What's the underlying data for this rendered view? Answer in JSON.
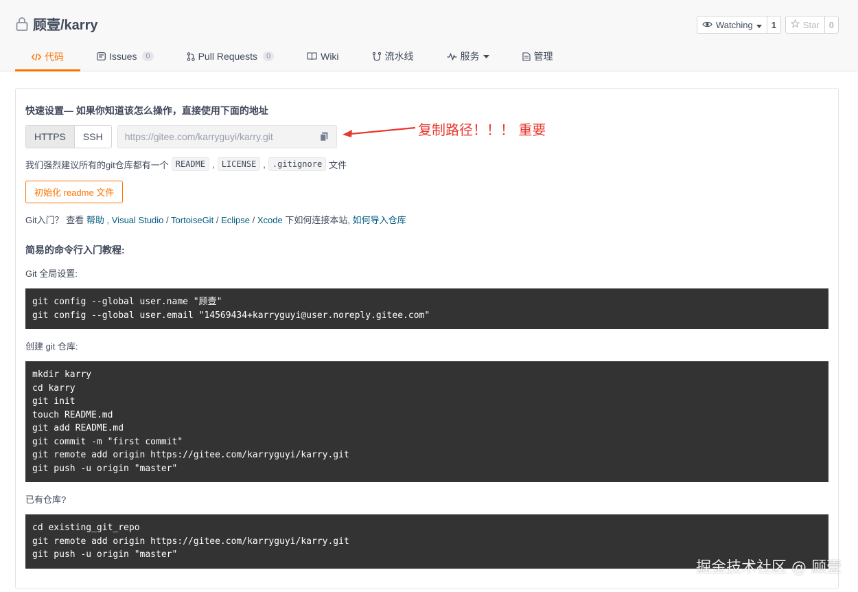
{
  "repo": {
    "name": "顾壹/karry"
  },
  "actions": {
    "watch": {
      "label": "Watching",
      "count": "1"
    },
    "star": {
      "label": "Star",
      "count": "0"
    }
  },
  "tabs": [
    {
      "label": "代码"
    },
    {
      "label": "Issues",
      "badge": "0"
    },
    {
      "label": "Pull Requests",
      "badge": "0"
    },
    {
      "label": "Wiki"
    },
    {
      "label": "流水线"
    },
    {
      "label": "服务"
    },
    {
      "label": "管理"
    }
  ],
  "quick": {
    "title": "快速设置— 如果你知道该怎么操作，直接使用下面的地址",
    "protocols": [
      "HTTPS",
      "SSH"
    ],
    "url_placeholder": "https://gitee.com/karryguyi/karry.git"
  },
  "annotation": {
    "text": "复制路径！！！ 重要"
  },
  "recommend": {
    "prefix": "我们强烈建议所有的git仓库都有一个",
    "files": [
      "README",
      "LICENSE",
      ".gitignore"
    ],
    "sep": ",",
    "suffix": "文件"
  },
  "init_button": "初始化 readme 文件",
  "git_help": {
    "prefix": "Git入门？ 查看",
    "help": "帮助",
    "tools_sep": ",",
    "vs": "Visual Studio",
    "tortoise": "TortoiseGit",
    "eclipse": "Eclipse",
    "xcode": "Xcode",
    "slash": "/",
    "middle": "下如何连接本站,",
    "import": "如何导入仓库"
  },
  "tutorial": {
    "title": "简易的命令行入门教程:",
    "global_label": "Git 全局设置:",
    "global_code": [
      "git config --global user.name \"顾壹\"",
      "git config --global user.email \"14569434+karryguyi@user.noreply.gitee.com\""
    ],
    "create_label": "创建 git 仓库:",
    "create_code": [
      "mkdir karry",
      "cd karry",
      "git init",
      "touch README.md",
      "git add README.md",
      "git commit -m \"first commit\"",
      "git remote add origin https://gitee.com/karryguyi/karry.git",
      "git push -u origin \"master\""
    ],
    "existing_label": "已有仓库?",
    "existing_code": [
      "cd existing_git_repo",
      "git remote add origin https://gitee.com/karryguyi/karry.git",
      "git push -u origin \"master\""
    ]
  },
  "watermark": "掘金技术社区 @ 顾壹",
  "colors": {
    "accent": "#fe7300",
    "link": "#005980",
    "annotation": "#e8392e",
    "code_bg": "#333333"
  }
}
